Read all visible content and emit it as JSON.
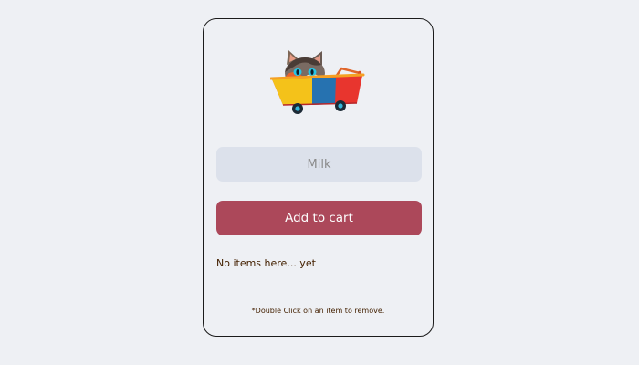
{
  "app": {
    "logo_icon": "cat-in-shopping-cart-icon",
    "input": {
      "placeholder": "Milk",
      "value": ""
    },
    "add_button_label": "Add to cart",
    "empty_message": "No items here... yet",
    "hint": "*Double Click on an item to remove."
  },
  "colors": {
    "background": "#eef0f4",
    "input_background": "#dce1eb",
    "button": "#ac485a",
    "text": "#432000",
    "border": "#1b1b1b"
  }
}
